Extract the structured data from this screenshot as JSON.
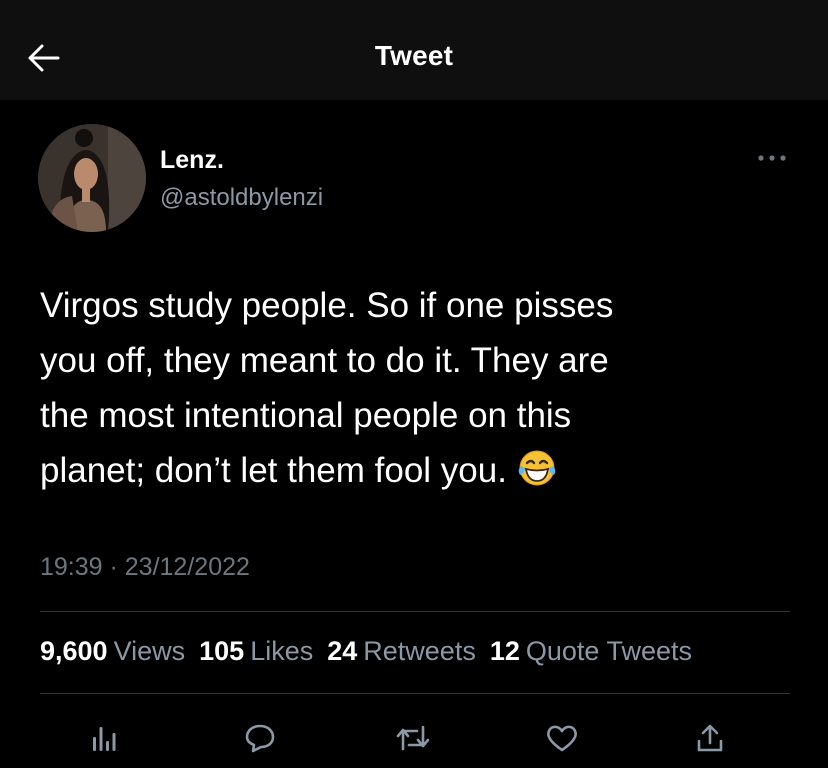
{
  "header": {
    "title": "Tweet",
    "back_icon": "arrow-left-icon"
  },
  "author": {
    "display_name": "Lenz.",
    "handle": "@astoldbylenzi"
  },
  "tweet": {
    "lines": [
      "Virgos study people. So if one pisses",
      "you off, they meant to do it. They are",
      "the most intentional people on this",
      "planet; don’t let them fool you."
    ],
    "emoji": "face-with-tears-of-joy",
    "timestamp": "19:39 · 23/12/2022"
  },
  "stats": [
    {
      "value": "9,600",
      "label": "Views"
    },
    {
      "value": "105",
      "label": "Likes"
    },
    {
      "value": "24",
      "label": "Retweets"
    },
    {
      "value": "12",
      "label": "Quote Tweets"
    }
  ],
  "actions": [
    "analytics-icon",
    "reply-icon",
    "retweet-icon",
    "like-icon",
    "share-icon"
  ],
  "colors": {
    "background": "#000000",
    "header_background": "#0f0f10",
    "text_primary": "#ffffff",
    "text_secondary": "#8b98a5",
    "divider": "#2f3336"
  }
}
